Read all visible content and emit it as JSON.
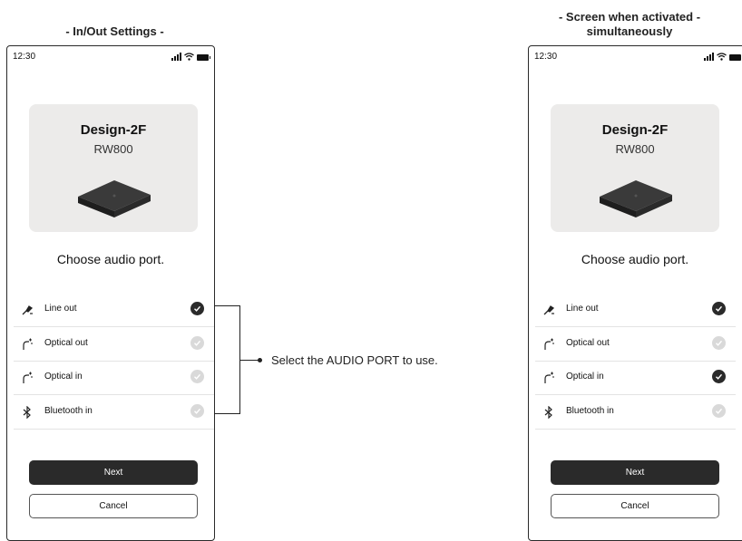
{
  "left": {
    "caption": "- In/Out Settings -",
    "status": {
      "time": "12:30"
    },
    "device": {
      "name": "Design-2F",
      "model": "RW800"
    },
    "title": "Choose audio port.",
    "ports": [
      {
        "label": "Line out",
        "icon": "line-out-icon",
        "selected": true
      },
      {
        "label": "Optical out",
        "icon": "optical-out-icon",
        "selected": false
      },
      {
        "label": "Optical in",
        "icon": "optical-in-icon",
        "selected": false
      },
      {
        "label": "Bluetooth in",
        "icon": "bluetooth-icon",
        "selected": false
      }
    ],
    "next_label": "Next",
    "cancel_label": "Cancel"
  },
  "right": {
    "caption_line1": "- Screen when activated -",
    "caption_line2": "simultaneously",
    "status": {
      "time": "12:30"
    },
    "device": {
      "name": "Design-2F",
      "model": "RW800"
    },
    "title": "Choose audio port.",
    "ports": [
      {
        "label": "Line out",
        "icon": "line-out-icon",
        "selected": true
      },
      {
        "label": "Optical out",
        "icon": "optical-out-icon",
        "selected": false
      },
      {
        "label": "Optical in",
        "icon": "optical-in-icon",
        "selected": true
      },
      {
        "label": "Bluetooth in",
        "icon": "bluetooth-icon",
        "selected": false
      }
    ],
    "next_label": "Next",
    "cancel_label": "Cancel"
  },
  "annotation": "Select the AUDIO PORT to use.",
  "colors": {
    "dark": "#2a2a2a",
    "card": "#ecebea",
    "unchecked": "#d9d9d9"
  }
}
